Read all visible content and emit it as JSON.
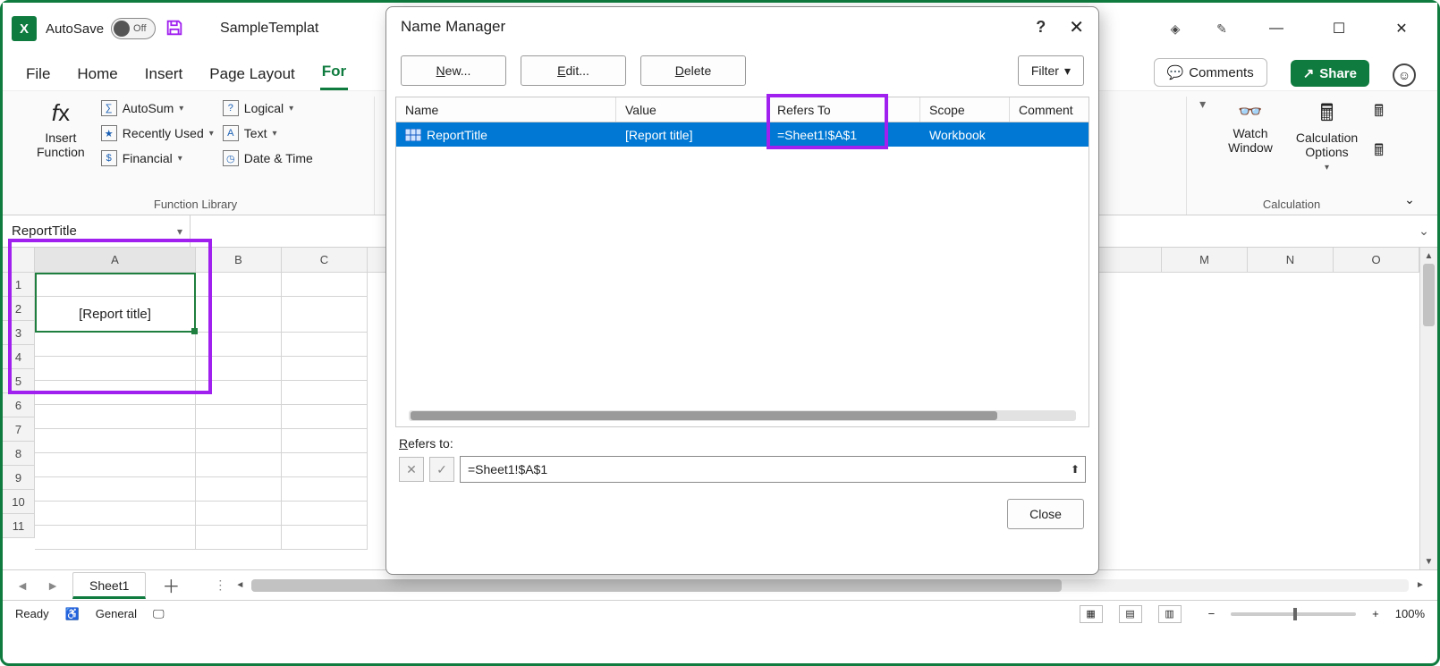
{
  "titlebar": {
    "autosave_label": "AutoSave",
    "autosave_state": "Off",
    "window_title": "SampleTemplat"
  },
  "tabs": {
    "file": "File",
    "home": "Home",
    "insert": "Insert",
    "page_layout": "Page Layout",
    "formulas": "For",
    "comments": "Comments",
    "share": "Share"
  },
  "ribbon": {
    "insert_function": "Insert\nFunction",
    "autosum": "AutoSum",
    "recently_used": "Recently Used",
    "financial": "Financial",
    "logical": "Logical",
    "text": "Text",
    "date_time": "Date & Time",
    "function_library": "Function Library",
    "watch_window": "Watch\nWindow",
    "calc_options": "Calculation\nOptions",
    "calculation": "Calculation"
  },
  "namebox": {
    "value": "ReportTitle"
  },
  "grid": {
    "cols": {
      "A": "A",
      "B": "B",
      "C": "C",
      "M": "M",
      "N": "N",
      "O": "O"
    },
    "rows": [
      "1",
      "2",
      "3",
      "4",
      "5",
      "6",
      "7",
      "8",
      "9",
      "10",
      "11"
    ],
    "a1": "",
    "a2": "[Report title]"
  },
  "sheet_tabs": {
    "sheet1": "Sheet1"
  },
  "status": {
    "ready": "Ready",
    "accessibility": "General",
    "zoom": "100%"
  },
  "dialog": {
    "title": "Name Manager",
    "new": "New...",
    "edit": "Edit...",
    "delete": "Delete",
    "filter": "Filter",
    "headers": {
      "name": "Name",
      "value": "Value",
      "refers": "Refers To",
      "scope": "Scope",
      "comment": "Comment"
    },
    "row1": {
      "name": "ReportTitle",
      "value": "[Report title]",
      "refers": "=Sheet1!$A$1",
      "scope": "Workbook",
      "comment": ""
    },
    "refers_label": "Refers to:",
    "refers_value": "=Sheet1!$A$1",
    "close": "Close"
  }
}
